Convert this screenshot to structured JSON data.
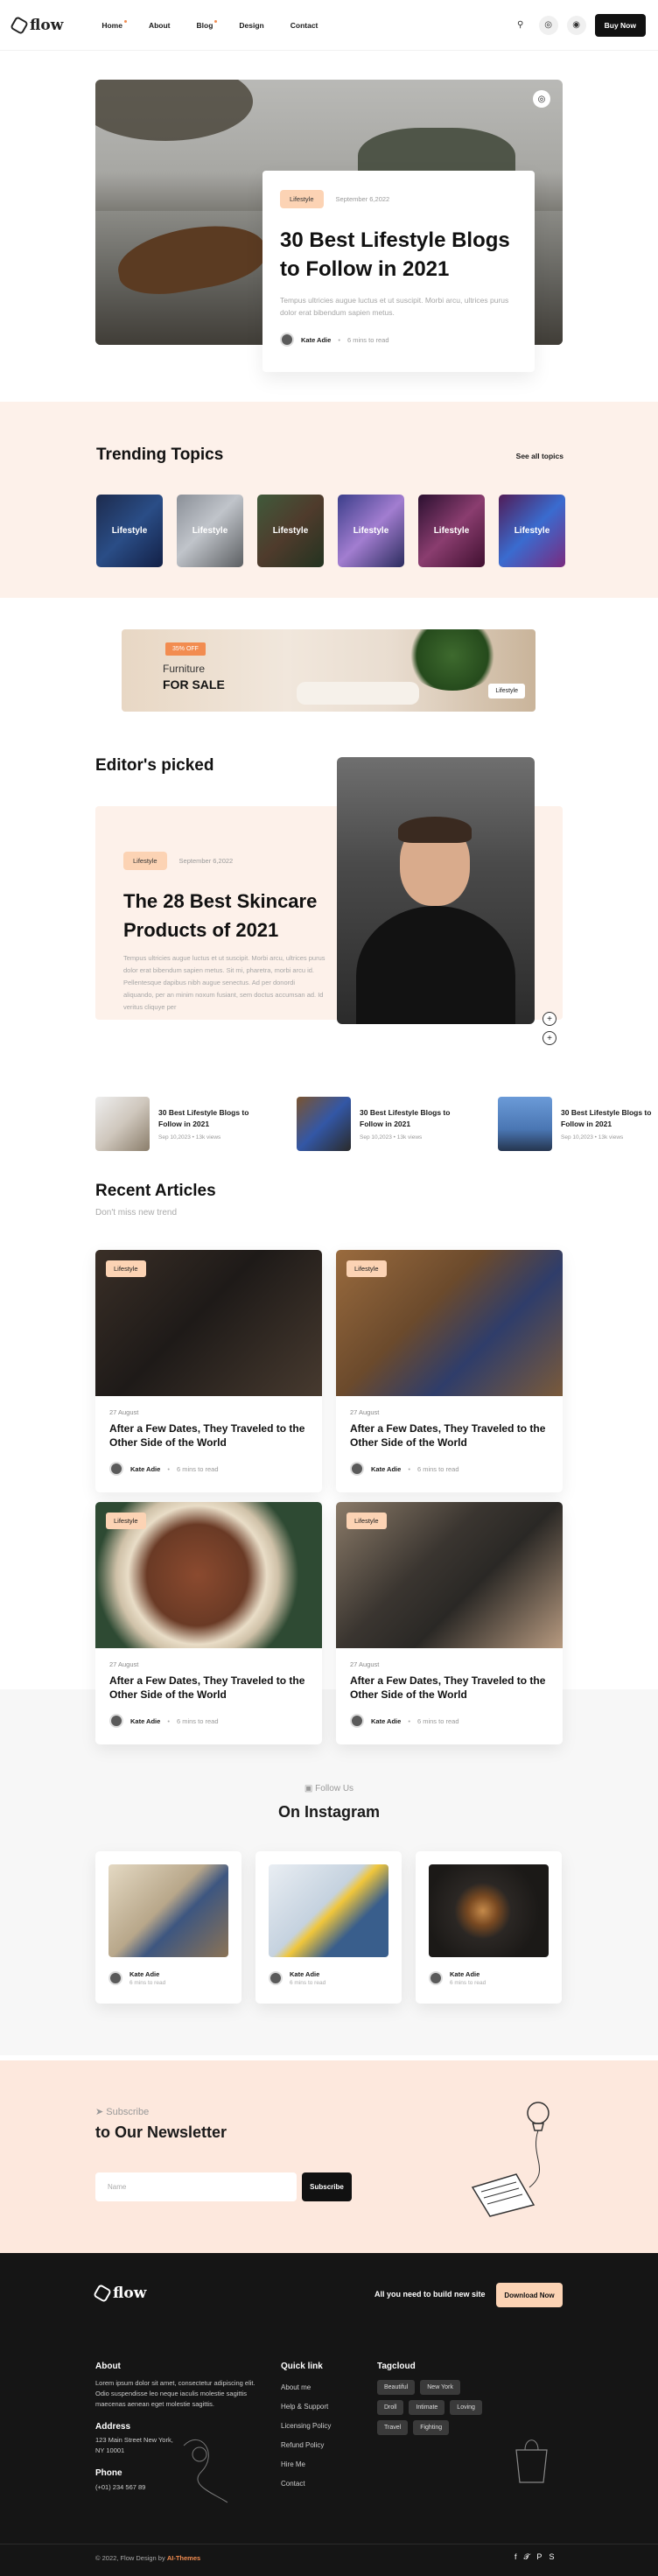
{
  "nav": {
    "logo": "flow",
    "menu": [
      "Home",
      "About",
      "Blog",
      "Design",
      "Contact"
    ],
    "buy_label": "Buy Now"
  },
  "hero": {
    "tag": "Lifestyle",
    "date": "September 6,2022",
    "title": "30 Best Lifestyle Blogs to Follow in 2021",
    "excerpt": "Tempus ultricies augue luctus et ut suscipit. Morbi arcu, ultrices purus dolor erat bibendum sapien metus.",
    "author": "Kate Adie",
    "read_time": "6 mins to read"
  },
  "trending": {
    "title": "Trending Topics",
    "see_all": "See all topics",
    "topics": [
      "Lifestyle",
      "Lifestyle",
      "Lifestyle",
      "Lifestyle",
      "Lifestyle",
      "Lifestyle"
    ]
  },
  "ad": {
    "badge": "35% OFF",
    "line1": "Furniture",
    "line2": "FOR SALE",
    "tag": "Lifestyle"
  },
  "editor": {
    "title": "Editor's picked",
    "tag": "Lifestyle",
    "date": "September 6,2022",
    "post_title": "The 28 Best Skincare Products of 2021",
    "excerpt": "Tempus ultricies augue luctus et ut suscipit. Morbi arcu, ultrices purus dolor erat bibendum sapien metus. Sit mi, pharetra, morbi arcu id. Pellentesque dapibus nibh augue senectus. Ad per donordi aliquando, per an minim noxum fusiant, sem doctus accumsan ad. Id veritus cliquye per",
    "mini": [
      {
        "title": "30 Best Lifestyle Blogs to Follow in 2021",
        "date": "Sep 10,2023",
        "views": "13k views"
      },
      {
        "title": "30 Best Lifestyle Blogs to Follow in 2021",
        "date": "Sep 10,2023",
        "views": "13k views"
      },
      {
        "title": "30 Best Lifestyle Blogs to Follow in 2021",
        "date": "Sep 10,2023",
        "views": "13k views"
      }
    ]
  },
  "recent": {
    "title": "Recent Articles",
    "subtitle": "Don't miss new trend",
    "cards": [
      {
        "tag": "Lifestyle",
        "date": "27 August",
        "title": "After a Few Dates, They Traveled to the Other Side of the World",
        "author": "Kate Adie",
        "read": "6 mins to read"
      },
      {
        "tag": "Lifestyle",
        "date": "27 August",
        "title": "After a Few Dates, They Traveled to the Other Side of the World",
        "author": "Kate Adie",
        "read": "6 mins to read"
      },
      {
        "tag": "Lifestyle",
        "date": "27 August",
        "title": "After a Few Dates, They Traveled to the Other Side of the World",
        "author": "Kate Adie",
        "read": "6 mins to read"
      },
      {
        "tag": "Lifestyle",
        "date": "27 August",
        "title": "After a Few Dates, They Traveled to the Other Side of the World",
        "author": "Kate Adie",
        "read": "6 mins to read"
      }
    ]
  },
  "instagram": {
    "follow": "Follow Us",
    "title": "On Instagram",
    "cards": [
      {
        "name": "Kate Adie",
        "sub": "6 mins to read"
      },
      {
        "name": "Kate Adie",
        "sub": "6 mins to read"
      },
      {
        "name": "Kate Adie",
        "sub": "6 mins to read"
      }
    ]
  },
  "newsletter": {
    "eyebrow": "Subscribe",
    "title": "to Our Newsletter",
    "placeholder": "Name",
    "button": "Subscribe"
  },
  "footer": {
    "logo": "flow",
    "cta_text": "All you need to build new site",
    "cta_button": "Download Now",
    "about_title": "About",
    "about_text": "Lorem ipsum dolor sit amet, consectetur adipiscing elit. Odio suspendisse leo neque iaculis molestie sagittis maecenas aenean eget molestie sagittis.",
    "address_title": "Address",
    "address": "123 Main Street New York, NY 10001",
    "phone_title": "Phone",
    "phone": "(+01) 234 567 89",
    "quick_title": "Quick link",
    "quick_links": [
      "About me",
      "Help & Support",
      "Licensing Policy",
      "Refund Policy",
      "Hire Me",
      "Contact"
    ],
    "tag_title": "Tagcloud",
    "tags": [
      "Beautiful",
      "New York",
      "Droll",
      "Intimate",
      "Loving",
      "Travel",
      "Fighting"
    ],
    "copyright_prefix": "© 2022, Flow Design by",
    "copyright_brand": "AI-Themes"
  }
}
